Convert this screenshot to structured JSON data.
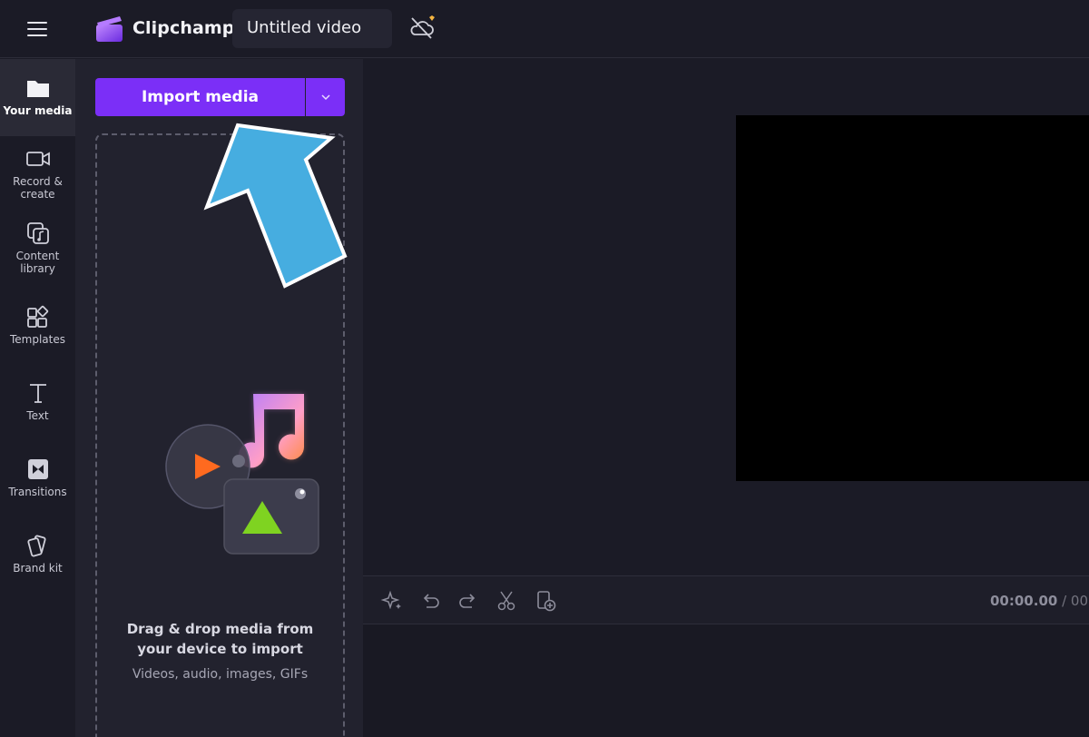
{
  "app": {
    "brand": "Clipchamp",
    "project_title": "Untitled video"
  },
  "sidebar": {
    "items": [
      {
        "label": "Your media",
        "icon": "folder-icon",
        "active": true
      },
      {
        "label": "Record &\ncreate",
        "icon": "camera-icon"
      },
      {
        "label": "Content\nlibrary",
        "icon": "content-library-icon"
      },
      {
        "label": "Templates",
        "icon": "templates-icon"
      },
      {
        "label": "Text",
        "icon": "text-icon"
      },
      {
        "label": "Transitions",
        "icon": "transitions-icon"
      },
      {
        "label": "Brand kit",
        "icon": "brand-kit-icon"
      }
    ]
  },
  "media_panel": {
    "import_label": "Import media",
    "drop_title": "Drag & drop media from\nyour device to import",
    "drop_subtitle": "Videos, audio, images, GIFs"
  },
  "timeline": {
    "timecode_current": "00:00.00",
    "timecode_rest": " / 00",
    "tools": [
      "magic-icon",
      "undo-icon",
      "redo-icon",
      "scissors-icon",
      "add-media-icon"
    ]
  },
  "colors": {
    "accent": "#7b2ff7",
    "background": "#1b1b26",
    "panel": "#22222e",
    "annotation_arrow": "#4ab0e0"
  }
}
